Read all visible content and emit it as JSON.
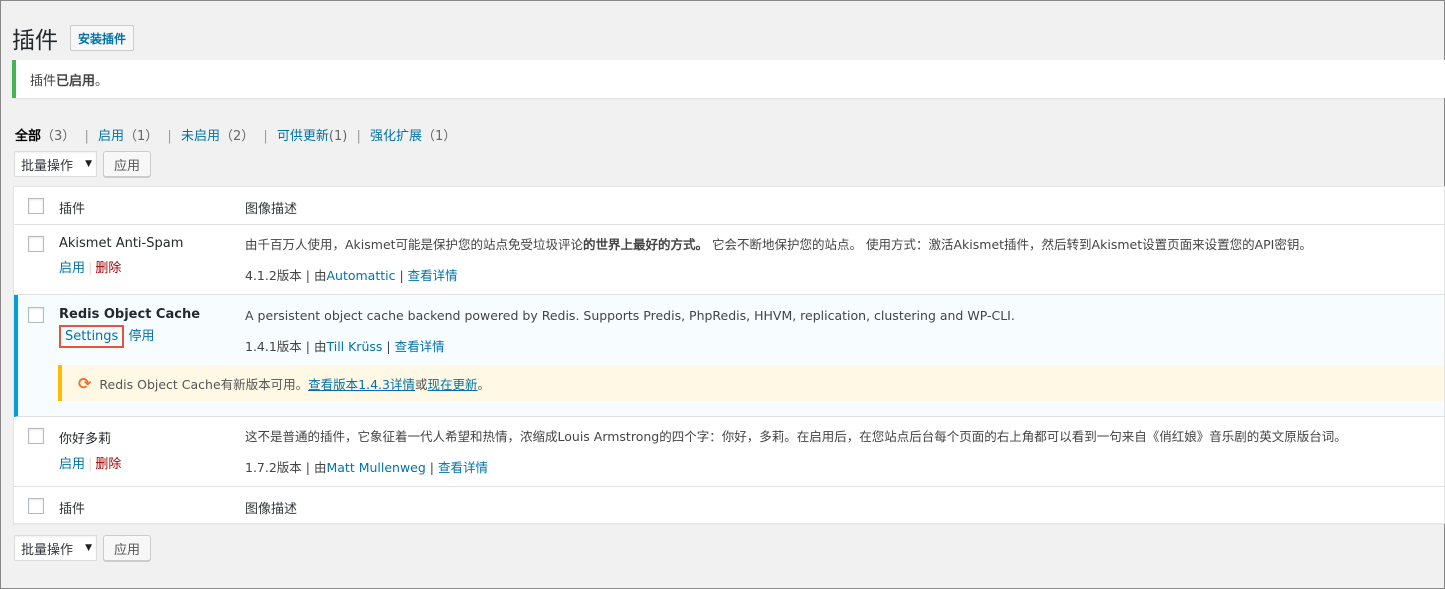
{
  "header": {
    "title": "插件",
    "add_new_label": "安装插件"
  },
  "notice": {
    "text_prefix": "插件",
    "text_bold": "已启用",
    "text_suffix": "。"
  },
  "filters": [
    {
      "label": "全部",
      "count": "（3）"
    },
    {
      "label": "启用",
      "count": "（1）"
    },
    {
      "label": "未启用",
      "count": "（2）"
    },
    {
      "label": "可供更新",
      "count": "(1)"
    },
    {
      "label": "强化扩展",
      "count": "（1）"
    }
  ],
  "bulk": {
    "select_label": "批量操作",
    "apply_label": "应用"
  },
  "table": {
    "col_plugin": "插件",
    "col_desc": "图像描述",
    "plugins": [
      {
        "name": "Akismet Anti-Spam",
        "action1": "启用",
        "action2": "删除",
        "desc_part1": "由千百万人使用，Akismet可能是保护您的站点免受垃圾评论",
        "desc_bold": "的世界上最好的方式。",
        "desc_part2": " 它会不断地保护您的站点。 使用方式：激活Akismet插件，然后转到Akismet设置页面来设置您的API密钥。",
        "version": "4.1.2版本 | 由",
        "author": "Automattic",
        "sep": " | ",
        "details": "查看详情"
      },
      {
        "name": "Redis Object Cache",
        "action1": "Settings",
        "action2": "停用",
        "desc": "A persistent object cache backend powered by Redis. Supports Predis, PhpRedis, HHVM, replication, clustering and WP-CLI.",
        "version": "1.4.1版本 | 由",
        "author": "Till Krüss",
        "sep": " | ",
        "details": "查看详情",
        "update": {
          "prefix": "Redis Object Cache有新版本可用。",
          "view_link": "查看版本1.4.3详情",
          "or": "或",
          "update_link": "现在更新",
          "end": "。"
        }
      },
      {
        "name": "你好多莉",
        "action1": "启用",
        "action2": "删除",
        "desc": "这不是普通的插件，它象征着一代人希望和热情，浓缩成Louis Armstrong的四个字：你好，多莉。在启用后，在您站点后台每个页面的右上角都可以看到一句来自《俏红娘》音乐剧的英文原版台词。",
        "version": "1.7.2版本 | 由",
        "author": "Matt Mullenweg",
        "sep": " | ",
        "details": "查看详情"
      }
    ]
  },
  "colors": {
    "accent": "#0073aa",
    "active_border": "#00a0d2",
    "notice_green": "#46b450",
    "update_orange": "#ffb900",
    "delete_red": "#aa0000",
    "highlight_red": "#e8533f"
  }
}
